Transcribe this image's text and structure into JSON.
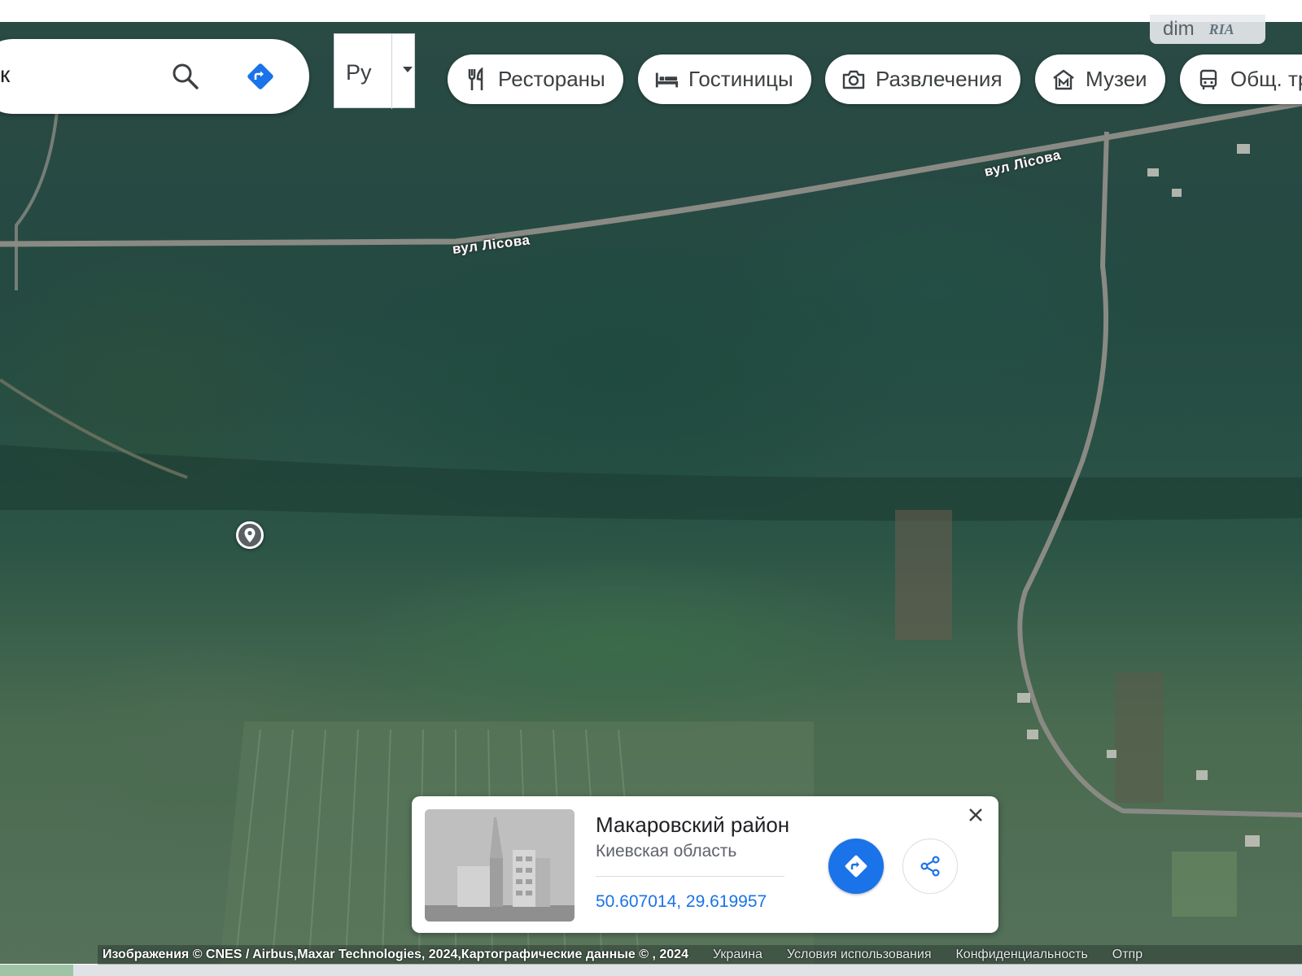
{
  "search": {
    "value": "к"
  },
  "language": {
    "selected": "Ру"
  },
  "category_chips": [
    {
      "label": "Рестораны",
      "icon": "fork-knife-icon"
    },
    {
      "label": "Гостиницы",
      "icon": "bed-icon"
    },
    {
      "label": "Развлечения",
      "icon": "camera-icon"
    },
    {
      "label": "Музеи",
      "icon": "museum-icon"
    },
    {
      "label": "Общ. тр",
      "icon": "bus-icon"
    }
  ],
  "logo": {
    "text": "dim",
    "badge": "RIA"
  },
  "map": {
    "road_labels": [
      "вул Лісова",
      "вул Лісова"
    ]
  },
  "place_card": {
    "title": "Макаровский район",
    "subtitle": "Киевская область",
    "coordinates": "50.607014, 29.619957"
  },
  "attribution": {
    "imagery": "Изображения © CNES / Airbus,Maxar Technologies, 2024,Картографические данные © , 2024",
    "country": "Украина",
    "terms": "Условия использования",
    "privacy": "Конфиденциальность",
    "send": "Отпр"
  },
  "colors": {
    "accent": "#1a73e8",
    "road": "#8a8a84"
  }
}
